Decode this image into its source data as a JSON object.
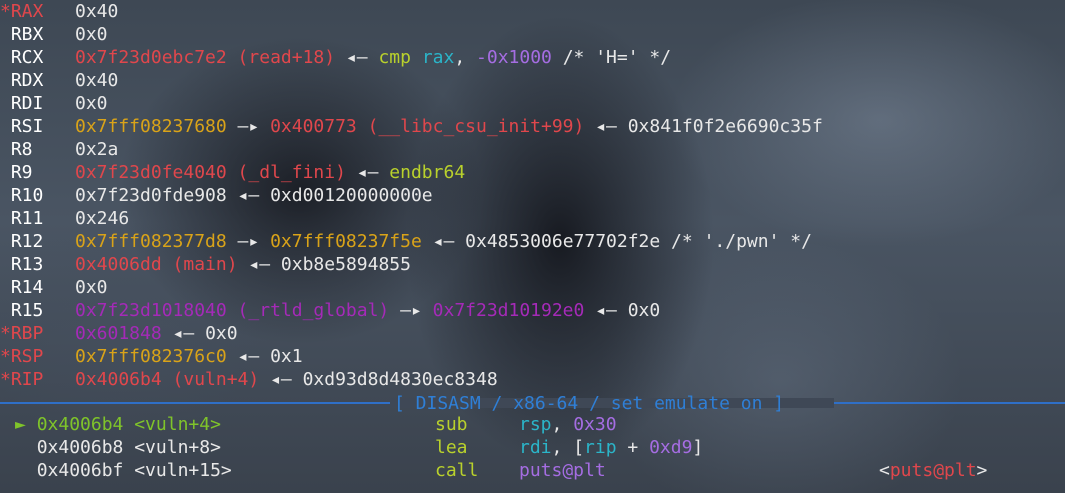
{
  "registers": [
    {
      "star": "*",
      "name": "RAX",
      "parts": [
        {
          "t": "0x40",
          "c": "white"
        }
      ]
    },
    {
      "star": " ",
      "name": "RBX",
      "parts": [
        {
          "t": "0x0",
          "c": "white"
        }
      ]
    },
    {
      "star": " ",
      "name": "RCX",
      "parts": [
        {
          "t": "0x7f23d0ebc7e2 (read+18)",
          "c": "red"
        },
        {
          "t": " ◂— ",
          "c": "arrow"
        },
        {
          "t": "cmp",
          "c": "lime"
        },
        {
          "t": " ",
          "c": "white"
        },
        {
          "t": "rax",
          "c": "cyan"
        },
        {
          "t": ", ",
          "c": "white"
        },
        {
          "t": "-0x1000",
          "c": "num"
        },
        {
          "t": " /* 'H=' */",
          "c": "white"
        }
      ]
    },
    {
      "star": " ",
      "name": "RDX",
      "parts": [
        {
          "t": "0x40",
          "c": "white"
        }
      ]
    },
    {
      "star": " ",
      "name": "RDI",
      "parts": [
        {
          "t": "0x0",
          "c": "white"
        }
      ]
    },
    {
      "star": " ",
      "name": "RSI",
      "parts": [
        {
          "t": "0x7fff08237680",
          "c": "yel"
        },
        {
          "t": " —▸ ",
          "c": "arrow"
        },
        {
          "t": "0x400773 (__libc_csu_init+99)",
          "c": "red"
        },
        {
          "t": " ◂— ",
          "c": "arrow"
        },
        {
          "t": "0x841f0f2e6690c35f",
          "c": "white"
        }
      ]
    },
    {
      "star": " ",
      "name": "R8",
      "parts": [
        {
          "t": "0x2a",
          "c": "white"
        }
      ]
    },
    {
      "star": " ",
      "name": "R9",
      "parts": [
        {
          "t": "0x7f23d0fe4040 (_dl_fini)",
          "c": "red"
        },
        {
          "t": " ◂— ",
          "c": "arrow"
        },
        {
          "t": "endbr64",
          "c": "lime"
        }
      ]
    },
    {
      "star": " ",
      "name": "R10",
      "parts": [
        {
          "t": "0x7f23d0fde908",
          "c": "white"
        },
        {
          "t": " ◂— ",
          "c": "arrow"
        },
        {
          "t": "0xd00120000000e",
          "c": "white"
        }
      ]
    },
    {
      "star": " ",
      "name": "R11",
      "parts": [
        {
          "t": "0x246",
          "c": "white"
        }
      ]
    },
    {
      "star": " ",
      "name": "R12",
      "parts": [
        {
          "t": "0x7fff082377d8",
          "c": "yel"
        },
        {
          "t": " —▸ ",
          "c": "arrow"
        },
        {
          "t": "0x7fff08237f5e",
          "c": "yel"
        },
        {
          "t": " ◂— ",
          "c": "arrow"
        },
        {
          "t": "0x4853006e77702f2e /* './pwn' */",
          "c": "white"
        }
      ]
    },
    {
      "star": " ",
      "name": "R13",
      "parts": [
        {
          "t": "0x4006dd (main)",
          "c": "red"
        },
        {
          "t": " ◂— ",
          "c": "arrow"
        },
        {
          "t": "0xb8e5894855",
          "c": "white"
        }
      ]
    },
    {
      "star": " ",
      "name": "R14",
      "parts": [
        {
          "t": "0x0",
          "c": "white"
        }
      ]
    },
    {
      "star": " ",
      "name": "R15",
      "parts": [
        {
          "t": "0x7f23d1018040 (_rtld_global)",
          "c": "purple"
        },
        {
          "t": " —▸ ",
          "c": "arrow"
        },
        {
          "t": "0x7f23d10192e0",
          "c": "purple"
        },
        {
          "t": " ◂— ",
          "c": "arrow"
        },
        {
          "t": "0x0",
          "c": "white"
        }
      ]
    },
    {
      "star": "*",
      "name": "RBP",
      "parts": [
        {
          "t": "0x601848",
          "c": "purple"
        },
        {
          "t": " ◂— ",
          "c": "arrow"
        },
        {
          "t": "0x0",
          "c": "white"
        }
      ]
    },
    {
      "star": "*",
      "name": "RSP",
      "parts": [
        {
          "t": "0x7fff082376c0",
          "c": "yel"
        },
        {
          "t": " ◂— ",
          "c": "arrow"
        },
        {
          "t": "0x1",
          "c": "white"
        }
      ]
    },
    {
      "star": "*",
      "name": "RIP",
      "parts": [
        {
          "t": "0x4006b4 (vuln+4)",
          "c": "red"
        },
        {
          "t": " ◂— ",
          "c": "arrow"
        },
        {
          "t": "0xd93d8d4830ec8348",
          "c": "white"
        }
      ]
    }
  ],
  "separator": {
    "label": "[ DISASM / x86-64 / set emulate on ]"
  },
  "disasm": [
    {
      "marker": "►",
      "addr": "0x4006b4 <vuln+4>",
      "op": "sub",
      "args": [
        {
          "t": "rsp",
          "c": "cyan"
        },
        {
          "t": ", ",
          "c": "white"
        },
        {
          "t": "0x30",
          "c": "num"
        }
      ],
      "right": "",
      "current": true
    },
    {
      "marker": " ",
      "addr": "0x4006b8 <vuln+8>",
      "op": "lea",
      "args": [
        {
          "t": "rdi",
          "c": "cyan"
        },
        {
          "t": ", [",
          "c": "white"
        },
        {
          "t": "rip",
          "c": "cyan"
        },
        {
          "t": " + ",
          "c": "white"
        },
        {
          "t": "0xd9",
          "c": "num"
        },
        {
          "t": "]",
          "c": "white"
        }
      ],
      "right": "",
      "current": false
    },
    {
      "marker": " ",
      "addr": "0x4006bf <vuln+15>",
      "op": "call",
      "args": [
        {
          "t": "puts@plt",
          "c": "num"
        }
      ],
      "right": "<puts@plt>",
      "current": false
    }
  ],
  "colors": {
    "modified": "#e0474c",
    "code": "#e0474c",
    "stack": "#d9a319",
    "data": "#a52ab8",
    "instruction": "#b9d12c",
    "register": "#2bb5c9",
    "separator": "#2f6fc7",
    "current": "#7fc42a"
  }
}
